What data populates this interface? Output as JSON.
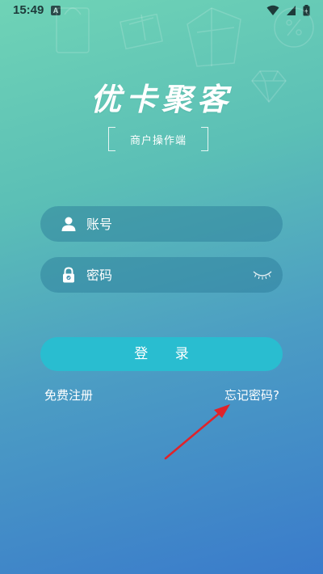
{
  "status_bar": {
    "time": "15:49",
    "app_icon_letter": "A",
    "icons": [
      "wifi-icon",
      "signal-icon",
      "battery-icon"
    ]
  },
  "header": {
    "logo_text": "优卡聚客",
    "subtitle": "商户操作端"
  },
  "form": {
    "account": {
      "placeholder": "账号",
      "value": "",
      "icon": "user-icon"
    },
    "password": {
      "placeholder": "密码",
      "value": "",
      "icon": "lock-icon",
      "toggle_icon": "eye-closed-icon"
    },
    "login_label": "登 录"
  },
  "links": {
    "register": "免费注册",
    "forgot_password": "忘记密码?"
  },
  "annotation": {
    "arrow_color": "#e0232a"
  },
  "colors": {
    "gradient_top": "#6fd3b6",
    "gradient_bottom": "#3a7bcb",
    "button": "#29bdd0"
  }
}
